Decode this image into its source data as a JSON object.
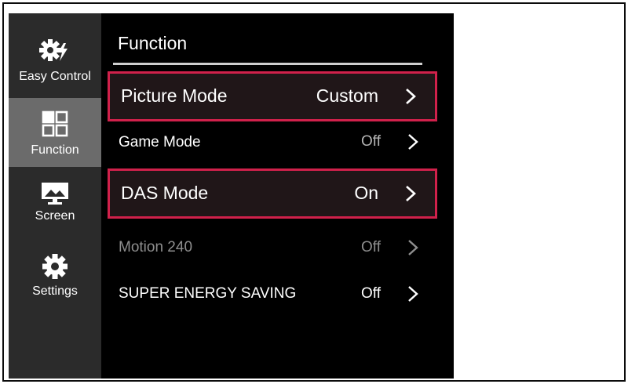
{
  "colors": {
    "sidebar_bg": "#2b2b2b",
    "sidebar_active_bg": "#6b6b6b",
    "panel_bg": "#000000",
    "highlight_border": "#d0214b",
    "text": "#ffffff",
    "dim_text": "#8e8e8e"
  },
  "sidebar": {
    "items": [
      {
        "label": "Easy Control",
        "icon": "gear-lightning-icon",
        "active": false
      },
      {
        "label": "Function",
        "icon": "function-grid-icon",
        "active": true
      },
      {
        "label": "Screen",
        "icon": "monitor-icon",
        "active": false
      },
      {
        "label": "Settings",
        "icon": "gear-icon",
        "active": false
      }
    ]
  },
  "panel": {
    "title": "Function",
    "rows": [
      {
        "label": "Picture Mode",
        "value": "Custom",
        "highlighted": true,
        "disabled": false
      },
      {
        "label": "Game Mode",
        "value": "Off",
        "highlighted": false,
        "disabled": false
      },
      {
        "label": "DAS Mode",
        "value": "On",
        "highlighted": true,
        "disabled": false
      },
      {
        "label": "Motion 240",
        "value": "Off",
        "highlighted": false,
        "disabled": true
      },
      {
        "label": "SUPER ENERGY SAVING",
        "value": "Off",
        "highlighted": false,
        "disabled": false
      }
    ]
  }
}
